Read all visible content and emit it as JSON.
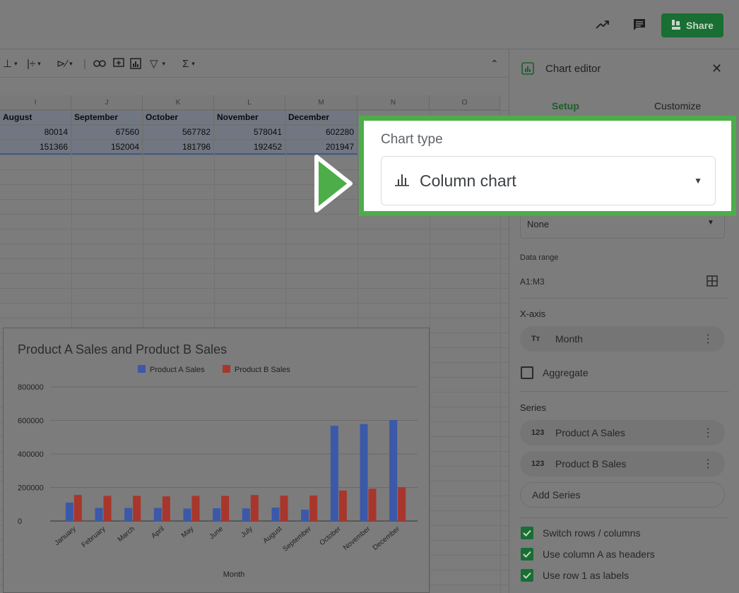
{
  "topbar": {
    "icons": [
      "trend-icon",
      "comment-icon"
    ],
    "share_label": "Share"
  },
  "toolbar": {
    "icons": [
      "valign-icon",
      "wrap-icon",
      "rotate-icon",
      "link-icon",
      "comment-add-icon",
      "chart-icon",
      "filter-icon",
      "functions-icon",
      "collapse-icon"
    ]
  },
  "grid": {
    "column_headers": [
      "I",
      "J",
      "K",
      "L",
      "M",
      "N",
      "O"
    ],
    "rows": [
      [
        "August",
        "September",
        "October",
        "November",
        "December"
      ],
      [
        "80014",
        "67560",
        "567782",
        "578041",
        "602280"
      ],
      [
        "151366",
        "152004",
        "181796",
        "192452",
        "201947"
      ]
    ]
  },
  "chart": {
    "title": "Product A Sales and Product B Sales",
    "legend": [
      "Product A Sales",
      "Product B Sales"
    ],
    "xlabel": "Month"
  },
  "chart_data": {
    "type": "bar",
    "title": "Product A Sales and Product B Sales",
    "xlabel": "Month",
    "ylabel": "",
    "categories": [
      "January",
      "February",
      "March",
      "April",
      "May",
      "June",
      "July",
      "August",
      "September",
      "October",
      "November",
      "December"
    ],
    "series": [
      {
        "name": "Product A Sales",
        "values": [
          110000,
          78000,
          78000,
          78000,
          74000,
          76000,
          75000,
          80014,
          67560,
          567782,
          578041,
          602280
        ]
      },
      {
        "name": "Product B Sales",
        "values": [
          155000,
          150000,
          150000,
          147000,
          150000,
          150000,
          155000,
          151366,
          152004,
          181796,
          192452,
          201947
        ]
      }
    ],
    "yticks": [
      "0",
      "200000",
      "400000",
      "600000",
      "800000"
    ],
    "ylim": [
      0,
      800000
    ],
    "grid": true,
    "legend_position": "top",
    "colors": {
      "Product A Sales": "#3b59a8",
      "Product B Sales": "#a8362c"
    }
  },
  "sidebar": {
    "title": "Chart editor",
    "tabs": [
      "Setup",
      "Customize"
    ],
    "stacking_value": "None",
    "data_range_label": "Data range",
    "data_range_value": "A1:M3",
    "xaxis_label": "X-axis",
    "xaxis_item": "Month",
    "aggregate_label": "Aggregate",
    "series_label": "Series",
    "series_items": [
      "Product A Sales",
      "Product B Sales"
    ],
    "add_series": "Add Series",
    "checkboxes": [
      {
        "label": "Switch rows / columns",
        "checked": true
      },
      {
        "label": "Use column A as headers",
        "checked": true
      },
      {
        "label": "Use row 1 as labels",
        "checked": true
      }
    ]
  },
  "callout": {
    "label": "Chart type",
    "value": "Column chart"
  },
  "colors": {
    "accent_green": "#4cad49",
    "share_green": "#186e33",
    "series_a": "#3b59a8",
    "series_b": "#a8362c"
  }
}
